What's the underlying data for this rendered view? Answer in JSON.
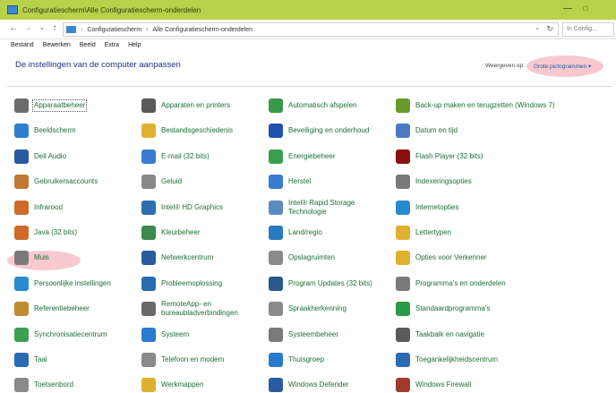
{
  "window": {
    "title": "Configuratiescherm\\Alle Configuratiescherm-onderdelen",
    "minimize_glyph": "—",
    "maximize_glyph": "□"
  },
  "address": {
    "back_glyph": "←",
    "forward_glyph": "→",
    "history_glyph": "⌄",
    "up_glyph": "↑",
    "crumb_sep": "›",
    "crumbs": [
      "Configuratiescherm",
      "Alle Configuratiescherm-onderdelen"
    ],
    "dropdown_glyph": "⌄",
    "refresh_glyph": "↻",
    "search_placeholder": "In Config..."
  },
  "menu": [
    "Bestand",
    "Bewerken",
    "Beeld",
    "Extra",
    "Help"
  ],
  "header": {
    "title": "De instellingen van de computer aanpassen",
    "view_label": "Weergeven op:",
    "view_value": "Grote pictogrammen ▾"
  },
  "items": [
    {
      "label": "Apparaatbeheer",
      "icon": "device-manager-icon",
      "color": "#6b6b6b"
    },
    {
      "label": "Apparaten en printers",
      "icon": "printer-icon",
      "color": "#5a5a5a"
    },
    {
      "label": "Automatisch afspelen",
      "icon": "autoplay-icon",
      "color": "#3a9a4a"
    },
    {
      "label": "Back-up maken en terugzetten (Windows 7)",
      "icon": "backup-icon",
      "color": "#6a9a2a"
    },
    {
      "label": "Beeldscherm",
      "icon": "display-icon",
      "color": "#2f7fd0"
    },
    {
      "label": "Bestandsgeschiedenis",
      "icon": "file-history-icon",
      "color": "#e0b030"
    },
    {
      "label": "Beveiliging en onderhoud",
      "icon": "security-flag-icon",
      "color": "#2050b0"
    },
    {
      "label": "Datum en tijd",
      "icon": "clock-icon",
      "color": "#4a7ac0"
    },
    {
      "label": "Dell Audio",
      "icon": "audio-icon",
      "color": "#2a5aa0"
    },
    {
      "label": "E-mail (32 bits)",
      "icon": "mail-icon",
      "color": "#3a7ad0"
    },
    {
      "label": "Energiebeheer",
      "icon": "power-icon",
      "color": "#3aa050"
    },
    {
      "label": "Flash Player (32 bits)",
      "icon": "flash-icon",
      "color": "#8a1010"
    },
    {
      "label": "Gebruikersaccounts",
      "icon": "users-icon",
      "color": "#c07a30"
    },
    {
      "label": "Geluid",
      "icon": "speaker-icon",
      "color": "#888888"
    },
    {
      "label": "Herstel",
      "icon": "recovery-icon",
      "color": "#3a7ad0"
    },
    {
      "label": "Indexeringsopties",
      "icon": "index-icon",
      "color": "#7a7a7a"
    },
    {
      "label": "Infrarood",
      "icon": "infrared-icon",
      "color": "#d06a2a"
    },
    {
      "label": "Intel® HD Graphics",
      "icon": "intel-graphics-icon",
      "color": "#2a70b0"
    },
    {
      "label": "Intel® Rapid Storage Technologie",
      "icon": "rapid-storage-icon",
      "color": "#5a8ac0"
    },
    {
      "label": "Internetopties",
      "icon": "internet-icon",
      "color": "#2a8ad0"
    },
    {
      "label": "Java (32 bits)",
      "icon": "java-icon",
      "color": "#d06a2a"
    },
    {
      "label": "Kleurbeheer",
      "icon": "color-icon",
      "color": "#3a8a4a"
    },
    {
      "label": "Land/regio",
      "icon": "globe-icon",
      "color": "#2a7ac0"
    },
    {
      "label": "Lettertypen",
      "icon": "fonts-icon",
      "color": "#e0b030"
    },
    {
      "label": "Muis",
      "icon": "mouse-icon",
      "color": "#7a7a7a"
    },
    {
      "label": "Netwerkcentrum",
      "icon": "network-icon",
      "color": "#2a5aa0"
    },
    {
      "label": "Opslagruimten",
      "icon": "storage-icon",
      "color": "#8a8a8a"
    },
    {
      "label": "Opties voor Verkenner",
      "icon": "folder-options-icon",
      "color": "#e0b030"
    },
    {
      "label": "Persoonlijke instellingen",
      "icon": "personalize-icon",
      "color": "#2a8ad0"
    },
    {
      "label": "Probleemoplossing",
      "icon": "troubleshoot-icon",
      "color": "#2a6ab0"
    },
    {
      "label": "Program Updates (32 bits)",
      "icon": "updates-icon",
      "color": "#2a5a8a"
    },
    {
      "label": "Programma's en onderdelen",
      "icon": "programs-icon",
      "color": "#7a7a7a"
    },
    {
      "label": "Referentiebeheer",
      "icon": "credentials-icon",
      "color": "#c08a30"
    },
    {
      "label": "RemoteApp- en bureaubladverbindingen",
      "icon": "remote-icon",
      "color": "#6a6a6a"
    },
    {
      "label": "Spraakherkenning",
      "icon": "microphone-icon",
      "color": "#8a8a8a"
    },
    {
      "label": "Standaardprogramma's",
      "icon": "default-programs-icon",
      "color": "#2a9a4a"
    },
    {
      "label": "Synchronisatiecentrum",
      "icon": "sync-icon",
      "color": "#3aa050"
    },
    {
      "label": "Systeem",
      "icon": "system-icon",
      "color": "#2a7ad0"
    },
    {
      "label": "Systeembeheer",
      "icon": "admin-tools-icon",
      "color": "#7a7a7a"
    },
    {
      "label": "Taakbalk en navigatie",
      "icon": "taskbar-icon",
      "color": "#5a5a5a"
    },
    {
      "label": "Taal",
      "icon": "language-icon",
      "color": "#2a6ab0"
    },
    {
      "label": "Telefoon en modem",
      "icon": "phone-icon",
      "color": "#8a8a8a"
    },
    {
      "label": "Thuisgroep",
      "icon": "homegroup-icon",
      "color": "#2a7ad0"
    },
    {
      "label": "Toegankelijkheidscentrum",
      "icon": "accessibility-icon",
      "color": "#2a6ab0"
    },
    {
      "label": "Toetsenbord",
      "icon": "keyboard-icon",
      "color": "#8a8a8a"
    },
    {
      "label": "Werkmappen",
      "icon": "work-folders-icon",
      "color": "#e0b030"
    },
    {
      "label": "Windows Defender",
      "icon": "defender-icon",
      "color": "#2a5aa0"
    },
    {
      "label": "Windows Firewall",
      "icon": "firewall-icon",
      "color": "#a03a2a"
    }
  ],
  "focused_item": "Apparaatbeheer",
  "highlighted_item": "Muis"
}
